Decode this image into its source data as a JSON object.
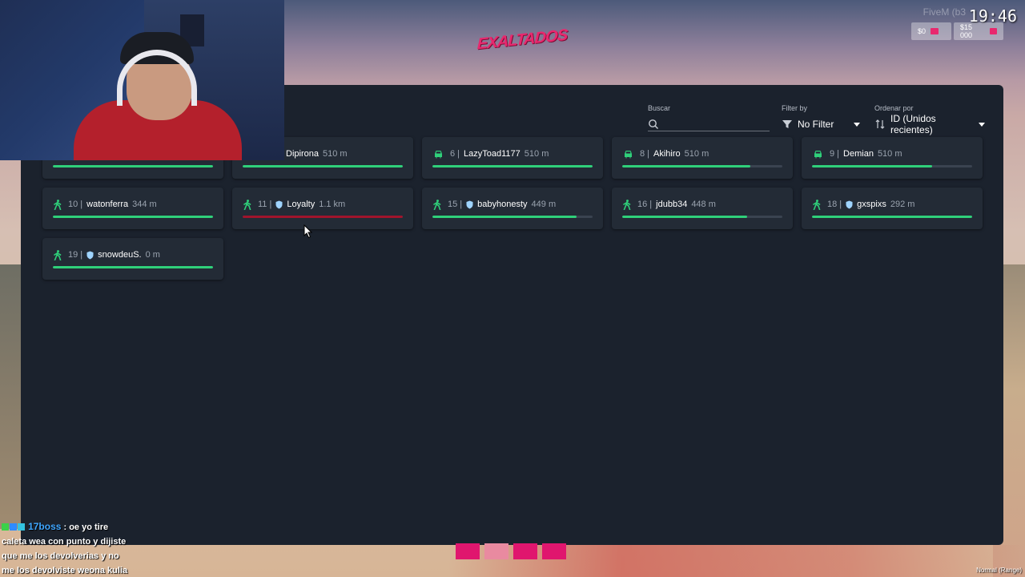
{
  "hud": {
    "watermark": "FiveM (b3",
    "clock": "19:46",
    "cash": "$0",
    "bank": "$15 000",
    "server_logo": "EXALTADOS"
  },
  "panel": {
    "search": {
      "label": "Buscar",
      "value": "",
      "placeholder": ""
    },
    "filter": {
      "label": "Filter by",
      "value": "No Filter"
    },
    "sort": {
      "label": "Ordenar por",
      "value": "ID (Unidos recientes)"
    }
  },
  "players": [
    {
      "id": "",
      "name": "",
      "dist": "",
      "mode": "none",
      "shield": false,
      "health": 1.0,
      "bar_color": "#2fd07a"
    },
    {
      "id": "",
      "name": "Dipirona",
      "dist": "510 m",
      "mode": "none",
      "shield": false,
      "health": 1.0,
      "bar_color": "#2fd07a"
    },
    {
      "id": "6",
      "name": "LazyToad1177",
      "dist": "510 m",
      "mode": "car",
      "shield": false,
      "health": 1.0,
      "bar_color": "#2fd07a"
    },
    {
      "id": "8",
      "name": "Akihiro",
      "dist": "510 m",
      "mode": "car",
      "shield": false,
      "health": 0.8,
      "bar_color": "#2fd07a"
    },
    {
      "id": "9",
      "name": "Demian",
      "dist": "510 m",
      "mode": "car",
      "shield": false,
      "health": 0.75,
      "bar_color": "#2fd07a"
    },
    {
      "id": "10",
      "name": "watonferra",
      "dist": "344 m",
      "mode": "walk",
      "shield": false,
      "health": 1.0,
      "bar_color": "#2fd07a"
    },
    {
      "id": "11",
      "name": "Loyalty",
      "dist": "1.1 km",
      "mode": "walk",
      "shield": true,
      "health": 1.0,
      "bar_color": "#a0142c"
    },
    {
      "id": "15",
      "name": "babyhonesty",
      "dist": "449 m",
      "mode": "walk",
      "shield": true,
      "health": 0.9,
      "bar_color": "#2fd07a"
    },
    {
      "id": "16",
      "name": "jdubb34",
      "dist": "448 m",
      "mode": "walk",
      "shield": false,
      "health": 0.78,
      "bar_color": "#2fd07a"
    },
    {
      "id": "18",
      "name": "gxspixs",
      "dist": "292 m",
      "mode": "walk",
      "shield": true,
      "health": 1.0,
      "bar_color": "#2fd07a"
    },
    {
      "id": "19",
      "name": "snowdeuS.",
      "dist": "0 m",
      "mode": "walk",
      "shield": true,
      "health": 1.0,
      "bar_color": "#2fd07a"
    }
  ],
  "chat": {
    "user": "17boss",
    "line1": ": oe yo tire",
    "line2": "caleta wea con punto y dijiste",
    "line3": "que me los devolverias y no",
    "line4": "me los devolviste weona kulia"
  },
  "mode_label": "Normal (Range)",
  "colors": {
    "accent_green": "#2fd07a",
    "danger_red": "#a0142c",
    "panel_bg": "#1b222d",
    "card_bg": "#232b36",
    "brand_pink": "#e8286e"
  }
}
